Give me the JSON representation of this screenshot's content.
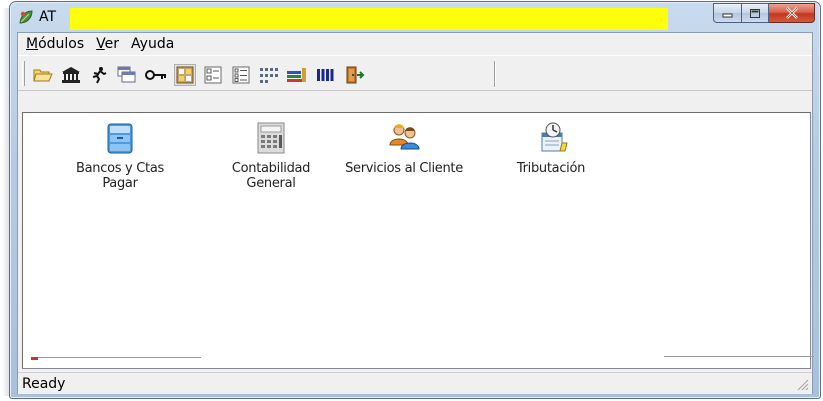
{
  "window": {
    "title_visible": "AT",
    "redaction_color": "#ffff0b"
  },
  "menu": {
    "items": [
      {
        "mnemonic": "M",
        "rest": "ódulos"
      },
      {
        "mnemonic": "V",
        "rest": "er"
      },
      {
        "mnemonic": "",
        "rest": "Ayuda"
      }
    ]
  },
  "toolbar": {
    "buttons": [
      "open-folder-icon",
      "bank-icon",
      "running-man-icon",
      "windows-cascade-icon",
      "key-icon",
      "large-icons-icon",
      "small-icons-icon",
      "list-icon",
      "details-icon",
      "books-icon",
      "columns-icon",
      "exit-door-icon"
    ],
    "pressed_index": 5
  },
  "modules": [
    {
      "line1": "Bancos y Ctas",
      "line2": "Pagar",
      "icon": "cash-drawer-icon"
    },
    {
      "line1": "Contabilidad",
      "line2": "General",
      "icon": "calculator-icon"
    },
    {
      "line1": "Servicios al Cliente",
      "line2": "",
      "icon": "customers-icon"
    },
    {
      "line1": "Tributación",
      "line2": "",
      "icon": "tax-icon"
    }
  ],
  "status": {
    "text": "Ready"
  }
}
